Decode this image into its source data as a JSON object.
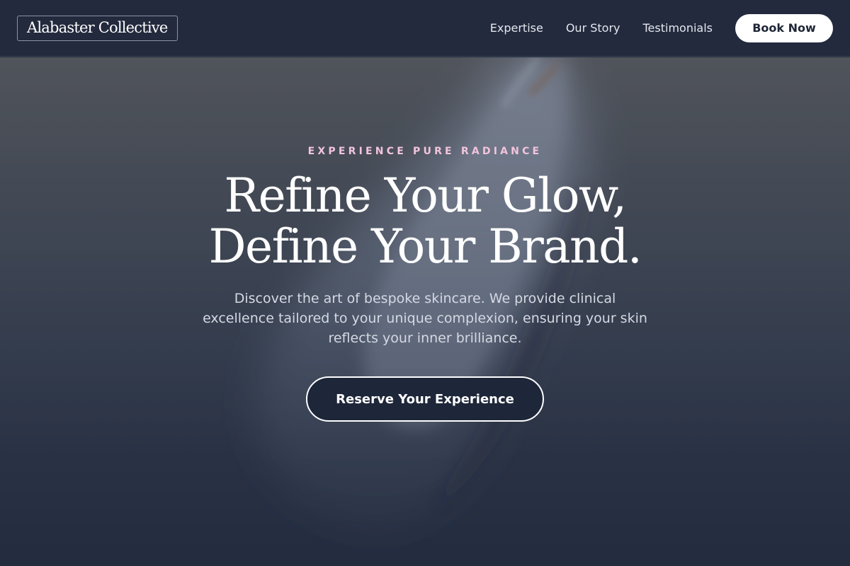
{
  "header": {
    "logo": "Alabaster Collective",
    "nav": [
      {
        "label": "Expertise"
      },
      {
        "label": "Our Story"
      },
      {
        "label": "Testimonials"
      }
    ],
    "book_label": "Book Now"
  },
  "hero": {
    "eyebrow": "EXPERIENCE PURE RADIANCE",
    "headline_line1": "Refine Your Glow,",
    "headline_line2": "Define Your Brand.",
    "subtext_line1": "Discover the art of bespoke skincare. We provide clinical",
    "subtext_line2": "excellence tailored to your unique complexion, ensuring your skin",
    "subtext_line3": "reflects your inner brilliance.",
    "cta_label": "Reserve Your Experience"
  },
  "colors": {
    "header_bg": "#232a3d",
    "eyebrow": "#f2c4dc",
    "cta_bg": "#1e2639",
    "text_white": "#ffffff"
  }
}
